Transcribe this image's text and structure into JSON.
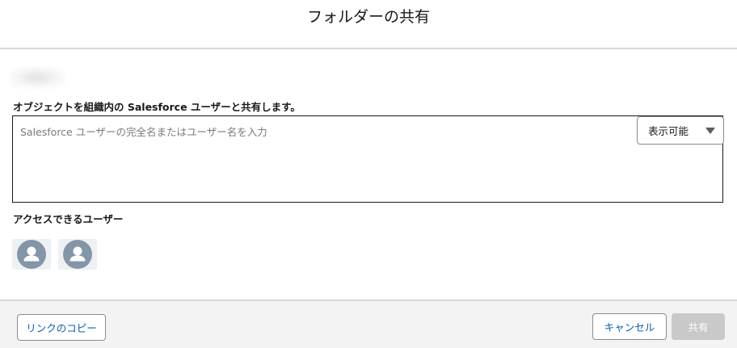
{
  "modal": {
    "title": "フォルダーの共有"
  },
  "share": {
    "label": "オブジェクトを組織内の Salesforce ユーザーと共有します。",
    "input_placeholder": "Salesforce ユーザーの完全名またはユーザー名を入力",
    "input_value": "",
    "access_level": "表示可能"
  },
  "access": {
    "label": "アクセスできるユーザー",
    "users": [
      {
        "icon": "user-icon"
      },
      {
        "icon": "user-icon"
      }
    ]
  },
  "footer": {
    "copy_link_label": "リンクのコピー",
    "cancel_label": "キャンセル",
    "share_label": "共有"
  },
  "colors": {
    "link_blue": "#0b5cab",
    "avatar_bg": "#8595a8",
    "disabled_button": "#c9c9c9"
  }
}
